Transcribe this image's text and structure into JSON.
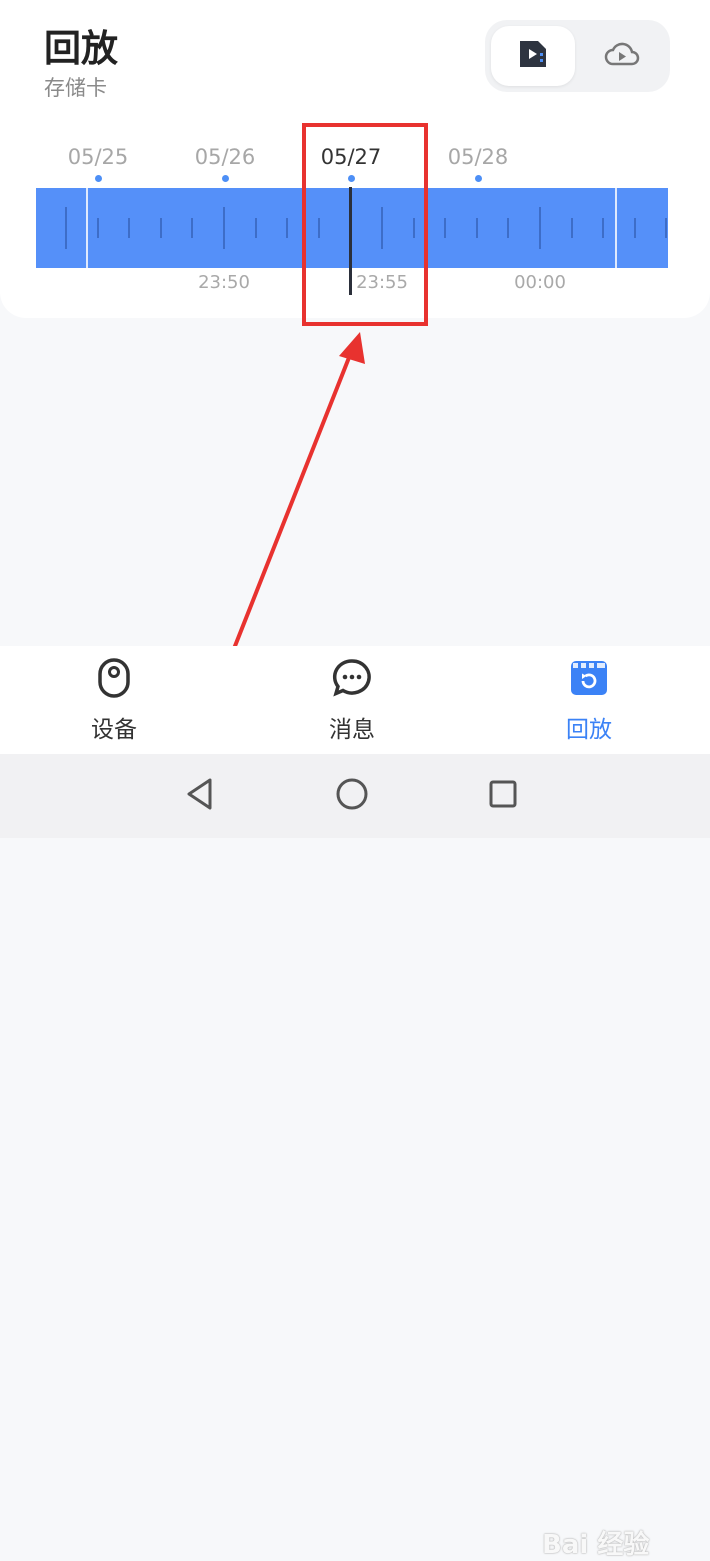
{
  "header": {
    "title": "回放",
    "subtitle": "存储卡"
  },
  "source_toggle": {
    "options": [
      {
        "icon": "sd-card-playback-icon",
        "selected": true
      },
      {
        "icon": "cloud-playback-icon",
        "selected": false
      }
    ]
  },
  "date_strip": {
    "dates": [
      "05/25",
      "05/26",
      "05/27",
      "05/28"
    ],
    "selected": "05/27"
  },
  "timeline": {
    "labels": [
      "23:50",
      "23:55",
      "00:00"
    ],
    "bar_color": "#5590f9"
  },
  "tabs": [
    {
      "label": "设备",
      "icon": "device-camera-icon",
      "active": false
    },
    {
      "label": "消息",
      "icon": "message-bubble-icon",
      "active": false
    },
    {
      "label": "回放",
      "icon": "playback-clapper-icon",
      "active": true
    }
  ],
  "system_nav": [
    "back-icon",
    "home-icon",
    "recents-icon"
  ],
  "watermark": "Bai 经验",
  "colors": {
    "accent": "#3b82f6",
    "highlight": "#e8322f"
  }
}
